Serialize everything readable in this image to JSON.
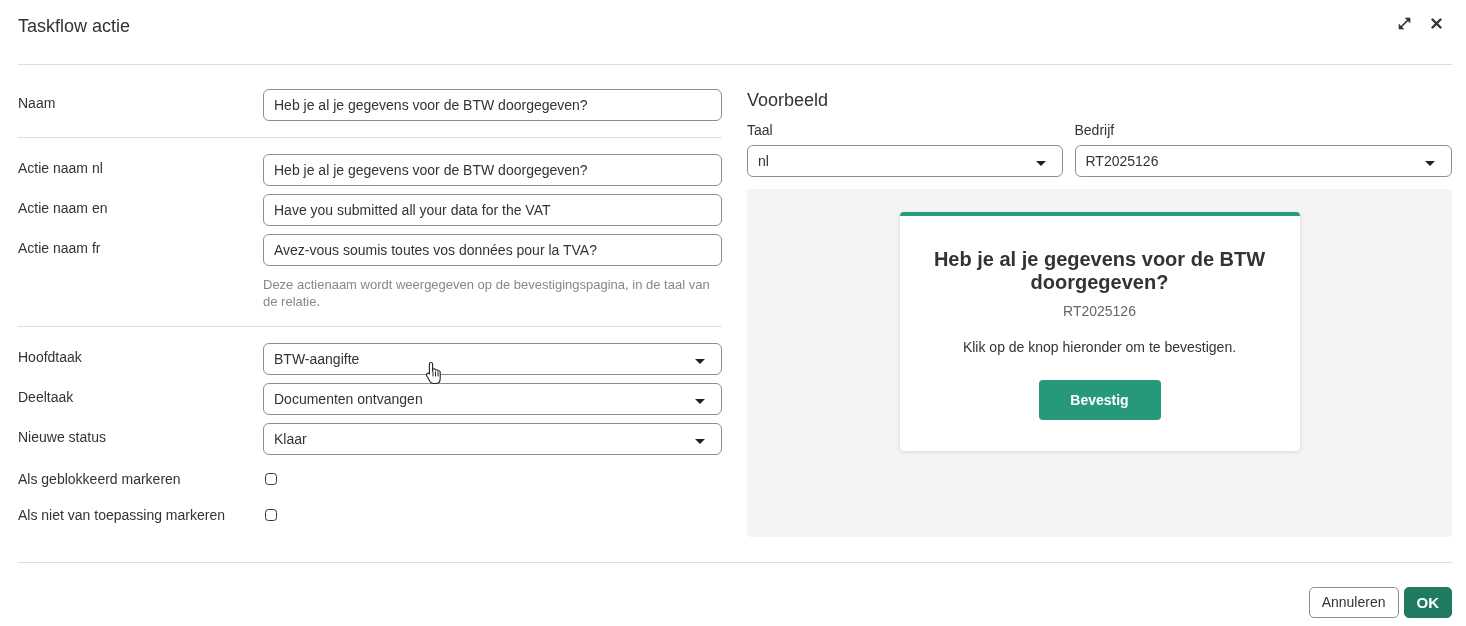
{
  "dialog": {
    "title": "Taskflow actie"
  },
  "form": {
    "sections": [
      {
        "fields": [
          {
            "kind": "text",
            "label": "Naam",
            "value": "Heb je al je gegevens voor de BTW doorgegeven?"
          }
        ]
      },
      {
        "fields": [
          {
            "kind": "text",
            "label": "Actie naam nl",
            "value": "Heb je al je gegevens voor de BTW doorgegeven?"
          },
          {
            "kind": "text",
            "label": "Actie naam en",
            "value": "Have you submitted all your data for the VAT"
          },
          {
            "kind": "text",
            "label": "Actie naam fr",
            "value": "Avez-vous soumis toutes vos données pour la TVA?"
          }
        ],
        "help": "Deze actienaam wordt weergegeven op de bevestigingspagina, in de taal van de relatie."
      },
      {
        "fields": [
          {
            "kind": "select",
            "label": "Hoofdtaak",
            "value": "BTW-aangifte"
          },
          {
            "kind": "select",
            "label": "Deeltaak",
            "value": "Documenten ontvangen"
          },
          {
            "kind": "select",
            "label": "Nieuwe status",
            "value": "Klaar"
          },
          {
            "kind": "checkbox",
            "label": "Als geblokkeerd markeren",
            "checked": false
          },
          {
            "kind": "checkbox",
            "label": "Als niet van toepassing markeren",
            "checked": false
          }
        ]
      }
    ]
  },
  "preview": {
    "title": "Voorbeeld",
    "filters": [
      {
        "label": "Taal",
        "value": "nl"
      },
      {
        "label": "Bedrijf",
        "value": "RT2025126"
      }
    ],
    "card": {
      "heading": "Heb je al je gegevens voor de BTW doorgegeven?",
      "code": "RT2025126",
      "message": "Klik op de knop hieronder om te bevestigen.",
      "button": "Bevestig"
    }
  },
  "footer": {
    "buttons": [
      {
        "label": "Annuleren",
        "kind": "secondary"
      },
      {
        "label": "OK",
        "kind": "primary"
      }
    ]
  }
}
